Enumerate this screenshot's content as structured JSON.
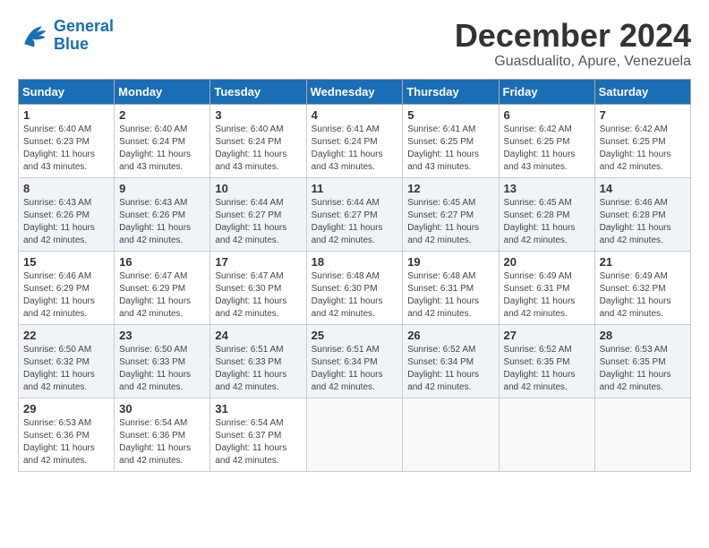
{
  "logo": {
    "text_general": "General",
    "text_blue": "Blue"
  },
  "title": "December 2024",
  "subtitle": "Guasdualito, Apure, Venezuela",
  "headers": [
    "Sunday",
    "Monday",
    "Tuesday",
    "Wednesday",
    "Thursday",
    "Friday",
    "Saturday"
  ],
  "weeks": [
    [
      {
        "day": "1",
        "sunrise": "6:40 AM",
        "sunset": "6:23 PM",
        "daylight": "11 hours and 43 minutes."
      },
      {
        "day": "2",
        "sunrise": "6:40 AM",
        "sunset": "6:24 PM",
        "daylight": "11 hours and 43 minutes."
      },
      {
        "day": "3",
        "sunrise": "6:40 AM",
        "sunset": "6:24 PM",
        "daylight": "11 hours and 43 minutes."
      },
      {
        "day": "4",
        "sunrise": "6:41 AM",
        "sunset": "6:24 PM",
        "daylight": "11 hours and 43 minutes."
      },
      {
        "day": "5",
        "sunrise": "6:41 AM",
        "sunset": "6:25 PM",
        "daylight": "11 hours and 43 minutes."
      },
      {
        "day": "6",
        "sunrise": "6:42 AM",
        "sunset": "6:25 PM",
        "daylight": "11 hours and 43 minutes."
      },
      {
        "day": "7",
        "sunrise": "6:42 AM",
        "sunset": "6:25 PM",
        "daylight": "11 hours and 42 minutes."
      }
    ],
    [
      {
        "day": "8",
        "sunrise": "6:43 AM",
        "sunset": "6:26 PM",
        "daylight": "11 hours and 42 minutes."
      },
      {
        "day": "9",
        "sunrise": "6:43 AM",
        "sunset": "6:26 PM",
        "daylight": "11 hours and 42 minutes."
      },
      {
        "day": "10",
        "sunrise": "6:44 AM",
        "sunset": "6:27 PM",
        "daylight": "11 hours and 42 minutes."
      },
      {
        "day": "11",
        "sunrise": "6:44 AM",
        "sunset": "6:27 PM",
        "daylight": "11 hours and 42 minutes."
      },
      {
        "day": "12",
        "sunrise": "6:45 AM",
        "sunset": "6:27 PM",
        "daylight": "11 hours and 42 minutes."
      },
      {
        "day": "13",
        "sunrise": "6:45 AM",
        "sunset": "6:28 PM",
        "daylight": "11 hours and 42 minutes."
      },
      {
        "day": "14",
        "sunrise": "6:46 AM",
        "sunset": "6:28 PM",
        "daylight": "11 hours and 42 minutes."
      }
    ],
    [
      {
        "day": "15",
        "sunrise": "6:46 AM",
        "sunset": "6:29 PM",
        "daylight": "11 hours and 42 minutes."
      },
      {
        "day": "16",
        "sunrise": "6:47 AM",
        "sunset": "6:29 PM",
        "daylight": "11 hours and 42 minutes."
      },
      {
        "day": "17",
        "sunrise": "6:47 AM",
        "sunset": "6:30 PM",
        "daylight": "11 hours and 42 minutes."
      },
      {
        "day": "18",
        "sunrise": "6:48 AM",
        "sunset": "6:30 PM",
        "daylight": "11 hours and 42 minutes."
      },
      {
        "day": "19",
        "sunrise": "6:48 AM",
        "sunset": "6:31 PM",
        "daylight": "11 hours and 42 minutes."
      },
      {
        "day": "20",
        "sunrise": "6:49 AM",
        "sunset": "6:31 PM",
        "daylight": "11 hours and 42 minutes."
      },
      {
        "day": "21",
        "sunrise": "6:49 AM",
        "sunset": "6:32 PM",
        "daylight": "11 hours and 42 minutes."
      }
    ],
    [
      {
        "day": "22",
        "sunrise": "6:50 AM",
        "sunset": "6:32 PM",
        "daylight": "11 hours and 42 minutes."
      },
      {
        "day": "23",
        "sunrise": "6:50 AM",
        "sunset": "6:33 PM",
        "daylight": "11 hours and 42 minutes."
      },
      {
        "day": "24",
        "sunrise": "6:51 AM",
        "sunset": "6:33 PM",
        "daylight": "11 hours and 42 minutes."
      },
      {
        "day": "25",
        "sunrise": "6:51 AM",
        "sunset": "6:34 PM",
        "daylight": "11 hours and 42 minutes."
      },
      {
        "day": "26",
        "sunrise": "6:52 AM",
        "sunset": "6:34 PM",
        "daylight": "11 hours and 42 minutes."
      },
      {
        "day": "27",
        "sunrise": "6:52 AM",
        "sunset": "6:35 PM",
        "daylight": "11 hours and 42 minutes."
      },
      {
        "day": "28",
        "sunrise": "6:53 AM",
        "sunset": "6:35 PM",
        "daylight": "11 hours and 42 minutes."
      }
    ],
    [
      {
        "day": "29",
        "sunrise": "6:53 AM",
        "sunset": "6:36 PM",
        "daylight": "11 hours and 42 minutes."
      },
      {
        "day": "30",
        "sunrise": "6:54 AM",
        "sunset": "6:36 PM",
        "daylight": "11 hours and 42 minutes."
      },
      {
        "day": "31",
        "sunrise": "6:54 AM",
        "sunset": "6:37 PM",
        "daylight": "11 hours and 42 minutes."
      },
      null,
      null,
      null,
      null
    ]
  ]
}
